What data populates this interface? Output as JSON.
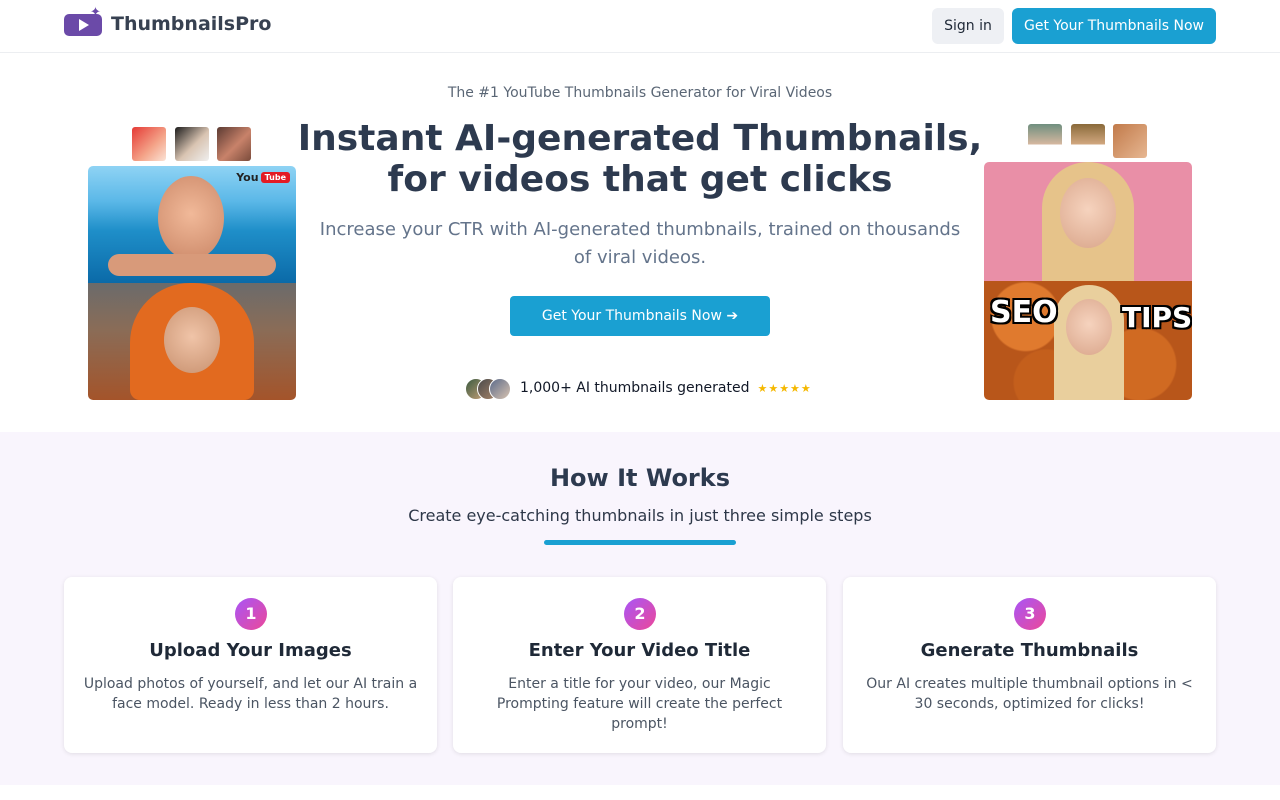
{
  "nav": {
    "brand": "ThumbnailsPro",
    "signin_label": "Sign in",
    "cta_label": "Get Your Thumbnails Now"
  },
  "hero": {
    "tagline": "The #1 YouTube Thumbnails Generator for Viral Videos",
    "headline_line1": "Instant AI-generated Thumbnails,",
    "headline_line2": "for videos that get clicks",
    "subhead": "Increase your CTR with AI-generated thumbnails, trained on thousands of viral videos.",
    "cta_label": "Get Your Thumbnails Now",
    "cta_icon": "arrow-right-icon",
    "social_proof": "1,000+ AI thumbnails generated",
    "rating_stars": 5
  },
  "left_gallery": {
    "badge_text": "You",
    "badge_tube": "Tube"
  },
  "right_gallery": {
    "overlay_left": "SEO",
    "overlay_right": "TIPS"
  },
  "how_it_works": {
    "title": "How It Works",
    "subtitle": "Create eye-catching thumbnails in just three simple steps",
    "steps": [
      {
        "number": "1",
        "title": "Upload Your Images",
        "description": "Upload photos of yourself, and let our AI train a face model. Ready in less than 2 hours."
      },
      {
        "number": "2",
        "title": "Enter Your Video Title",
        "description": "Enter a title for your video, our Magic Prompting feature will create the perfect prompt!"
      },
      {
        "number": "3",
        "title": "Generate Thumbnails",
        "description": "Our AI creates multiple thumbnail options in < 30 seconds, optimized for clicks!"
      }
    ]
  },
  "colors": {
    "accent": "#1aa0d2",
    "brand_purple": "#6b4aa8",
    "section_bg": "#f9f5fd",
    "star": "#f5b800"
  }
}
